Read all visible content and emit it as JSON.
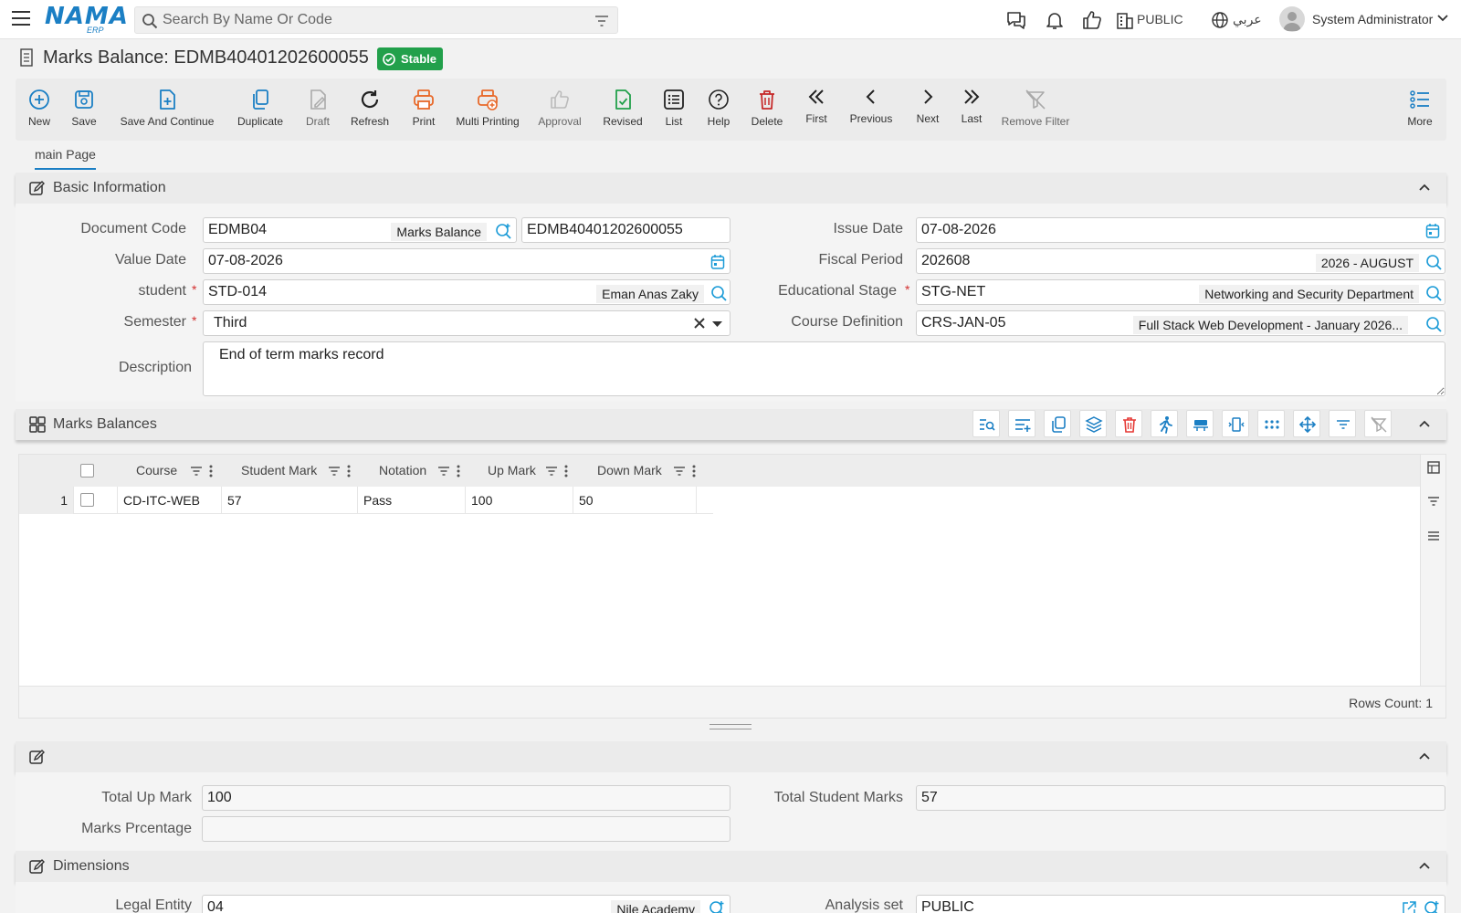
{
  "topbar": {
    "logo_text": "NAMA",
    "logo_sub": "ERP",
    "search_placeholder": "Search By Name Or Code",
    "public_label": "PUBLIC",
    "language_label": "عربي",
    "user_name": "System Administrator"
  },
  "title": {
    "text": "Marks Balance: EDMB40401202600055",
    "status": "Stable",
    "status_color": "#22a04b"
  },
  "toolbar": {
    "new": "New",
    "save": "Save",
    "save_continue": "Save And Continue",
    "duplicate": "Duplicate",
    "draft": "Draft",
    "refresh": "Refresh",
    "print": "Print",
    "multi_printing": "Multi Printing",
    "approval": "Approval",
    "revised": "Revised",
    "list": "List",
    "help": "Help",
    "delete": "Delete",
    "first": "First",
    "previous": "Previous",
    "next": "Next",
    "last": "Last",
    "remove_filter": "Remove Filter",
    "more": "More"
  },
  "tabs": {
    "main": "main Page"
  },
  "basic_info": {
    "title": "Basic Information",
    "document_code": {
      "label": "Document Code",
      "code": "EDMB04",
      "name": "Marks Balance",
      "number": "EDMB40401202600055"
    },
    "issue_date": {
      "label": "Issue Date",
      "value": "07-08-2026"
    },
    "value_date": {
      "label": "Value Date",
      "value": "07-08-2026"
    },
    "fiscal_period": {
      "label": "Fiscal Period",
      "value": "202608",
      "name": "2026 - AUGUST"
    },
    "student": {
      "label": "student",
      "value": "STD-014",
      "name": "Eman Anas Zaky"
    },
    "educational_stage": {
      "label": "Educational Stage",
      "value": "STG-NET",
      "name": "Networking and Security Department"
    },
    "semester": {
      "label": "Semester",
      "value": "Third"
    },
    "course_definition": {
      "label": "Course Definition",
      "value": "CRS-JAN-05",
      "name": "Full Stack Web Development - January 2026..."
    },
    "description": {
      "label": "Description",
      "value": "End of term marks record"
    }
  },
  "marks_balances": {
    "title": "Marks Balances",
    "columns": [
      "Course",
      "Student Mark",
      "Notation",
      "Up Mark",
      "Down Mark"
    ],
    "rows": [
      {
        "index": "1",
        "course": "CD-ITC-WEB",
        "student_mark": "57",
        "notation": "Pass",
        "up_mark": "100",
        "down_mark": "50"
      }
    ],
    "rows_count": "Rows Count: 1"
  },
  "totals": {
    "total_up_mark": {
      "label": "Total Up Mark",
      "value": "100"
    },
    "total_student_marks": {
      "label": "Total Student Marks",
      "value": "57"
    },
    "marks_percentage": {
      "label": "Marks Prcentage",
      "value": ""
    }
  },
  "dimensions": {
    "title": "Dimensions",
    "legal_entity": {
      "label": "Legal Entity",
      "value": "04",
      "name": "Nile Academy"
    },
    "analysis_set": {
      "label": "Analysis set",
      "value": "PUBLIC"
    }
  },
  "colors": {
    "accent": "#1b7fc4",
    "orange": "#e8692a",
    "green": "#22a04b",
    "red": "#c62828"
  }
}
